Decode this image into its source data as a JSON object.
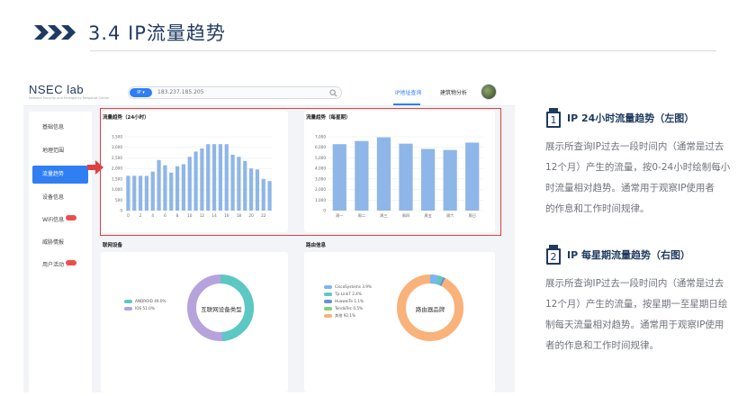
{
  "slide": {
    "title": "3.4 IP流量趋势"
  },
  "app": {
    "logo": "NSEC lab",
    "logo_sub": "Network Security and Emergency Response Center",
    "search_type": "IP",
    "search_value": "183.237.185.205",
    "nav": [
      {
        "label": "IP地址查询"
      },
      {
        "label": "建筑物分析"
      }
    ],
    "sidebar": [
      {
        "label": "基础信息"
      },
      {
        "label": "地理范围"
      },
      {
        "label": "流量趋势"
      },
      {
        "label": "设备信息"
      },
      {
        "label": "WiFi信息"
      },
      {
        "label": "威胁情报"
      },
      {
        "label": "用户活动"
      }
    ],
    "colors": {
      "accent": "#2f7ef2",
      "bar": "#8fb6e8",
      "highlight": "#e04040",
      "teal": "#5bc8c4",
      "purple": "#b6a2dd",
      "orange": "#f9b27a"
    }
  },
  "hourly_card": {
    "title": "流量趋势（24小时）"
  },
  "weekly_card": {
    "title": "流量趋势（每星期）"
  },
  "devices_section": {
    "title": "联网设备",
    "center_label": "互联网设备类型",
    "legend": [
      "ANDROID 49.0%",
      "IOS 51.0%"
    ]
  },
  "router_section": {
    "title": "路由信息",
    "center_label": "路由器品牌",
    "legend": [
      "CiscoSystems 3.9%",
      "Tp-LinkT 2.4%",
      "HuaweiTe 1.1%",
      "TendaTec 0.5%",
      "其他 92.1%"
    ]
  },
  "chart_data": [
    {
      "type": "bar",
      "title": "流量趋势（24小时）",
      "categories": [
        "0",
        "1",
        "2",
        "3",
        "4",
        "5",
        "6",
        "7",
        "8",
        "9",
        "10",
        "11",
        "12",
        "13",
        "14",
        "15",
        "16",
        "17",
        "18",
        "19",
        "20",
        "21",
        "22",
        "23"
      ],
      "x_tick_labels": [
        "0",
        "2",
        "4",
        "6",
        "8",
        "10",
        "12",
        "14",
        "16",
        "18",
        "20",
        "22"
      ],
      "values": [
        1650,
        1650,
        1650,
        1650,
        1850,
        2400,
        2150,
        1800,
        2100,
        2200,
        2550,
        2800,
        2950,
        3150,
        3150,
        3150,
        3150,
        2650,
        2550,
        2350,
        2000,
        1950,
        1500,
        1400
      ],
      "ylim": [
        0,
        3500
      ],
      "y_ticks": [
        "0",
        "500",
        "1,000",
        "1,500",
        "2,000",
        "2,500",
        "3,000",
        "3,500"
      ],
      "grid": true
    },
    {
      "type": "bar",
      "title": "流量趋势（每星期）",
      "categories": [
        "周一",
        "周二",
        "周三",
        "周四",
        "周五",
        "周六",
        "周日"
      ],
      "values": [
        6300,
        6600,
        6950,
        6350,
        5850,
        5750,
        6450
      ],
      "ylim": [
        0,
        7000
      ],
      "y_ticks": [
        "0",
        "1,000",
        "2,000",
        "3,000",
        "4,000",
        "5,000",
        "6,000",
        "7,000"
      ],
      "grid": true
    }
  ],
  "descriptions": [
    {
      "number": "1",
      "title": "IP 24小时流量趋势（左图）",
      "lines": [
        "展示所查询IP过去一段时间内（通常是过去",
        "12个月）产生的流量，按0-24小时绘制每小",
        "时流量相对趋势。通常用于观察IP使用者",
        "的作息和工作时间规律。"
      ]
    },
    {
      "number": "2",
      "title": "IP 每星期流量趋势（右图）",
      "lines": [
        "展示所查询IP过去一段时间内（通常是过去",
        "12个月）产生的流量，按星期一至星期日绘",
        "制每天流量相对趋势。通常用于观察IP使用",
        "者的作息和工作时间规律。"
      ]
    }
  ]
}
